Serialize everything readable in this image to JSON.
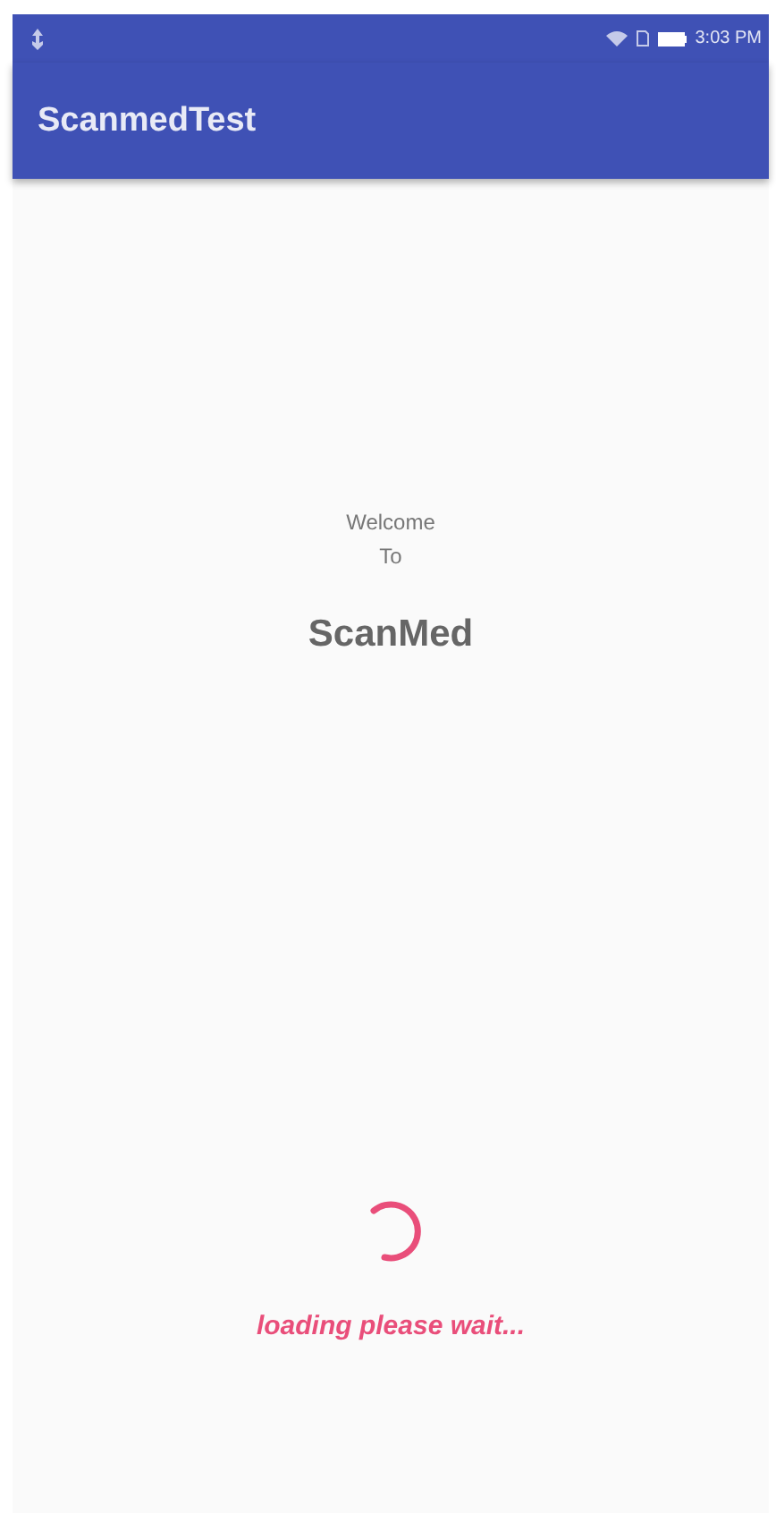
{
  "status_bar": {
    "time": "3:03 PM"
  },
  "app_bar": {
    "title": "ScanmedTest"
  },
  "splash": {
    "welcome": "Welcome",
    "to": "To",
    "app_name": "ScanMed"
  },
  "loading": {
    "message": "loading please wait..."
  }
}
